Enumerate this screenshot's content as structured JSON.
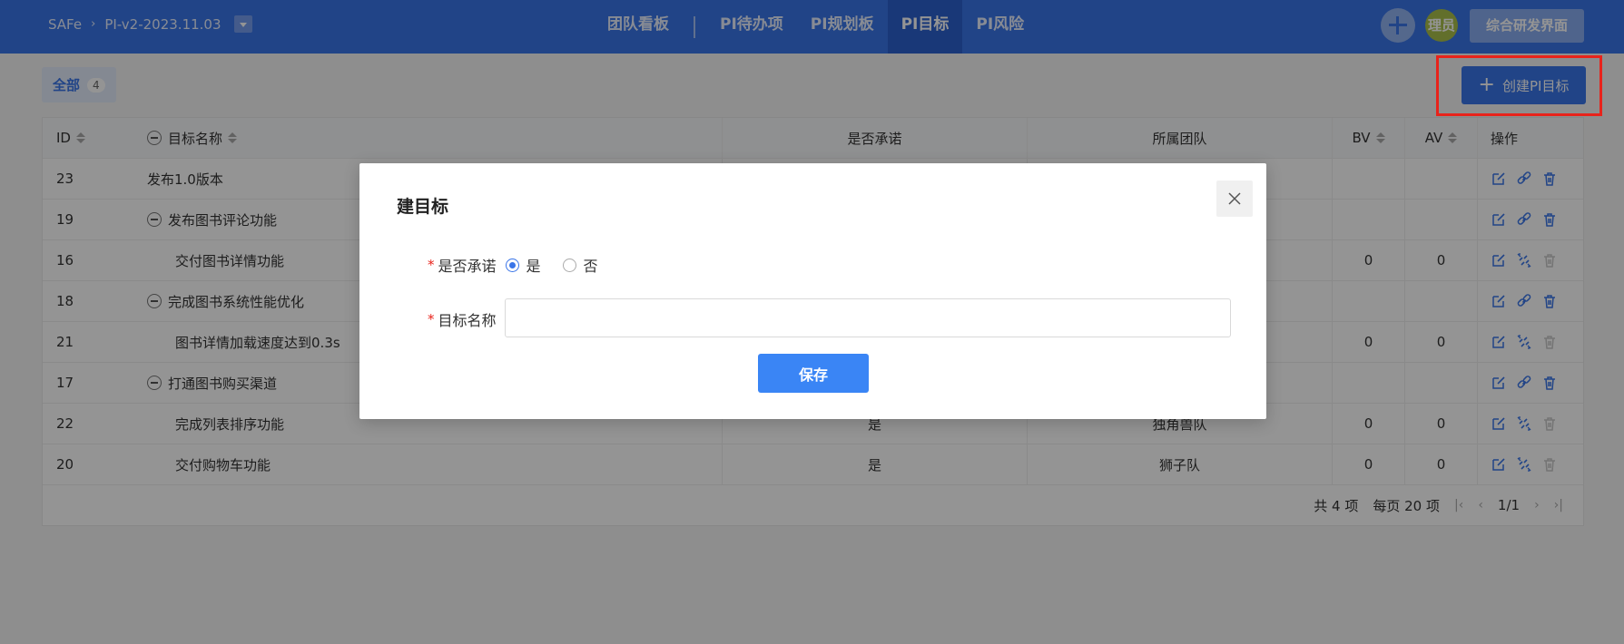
{
  "header": {
    "breadcrumb_root": "SAFe",
    "breadcrumb_sep": "›",
    "breadcrumb_pi": "PI-v2-2023.11.03",
    "nav": [
      {
        "label": "团队看板"
      },
      {
        "label": "PI待办项"
      },
      {
        "label": "PI规划板"
      },
      {
        "label": "PI目标"
      },
      {
        "label": "PI风险"
      }
    ],
    "avatar_text": "理员",
    "switch_label": "综合研发界面"
  },
  "toolbar": {
    "filter_label": "全部",
    "filter_count": "4",
    "create_plus": "+",
    "create_label": "创建PI目标"
  },
  "table": {
    "headers": {
      "id": "ID",
      "name": "目标名称",
      "commit": "是否承诺",
      "team": "所属团队",
      "bv": "BV",
      "av": "AV",
      "op": "操作"
    },
    "rows": [
      {
        "id": "23",
        "name": "发布1.0版本",
        "commit": "",
        "team": "",
        "bv": "",
        "av": ""
      },
      {
        "id": "19",
        "name": "发布图书评论功能",
        "commit": "",
        "team": "",
        "bv": "",
        "av": ""
      },
      {
        "id": "16",
        "name": "交付图书详情功能",
        "commit": "",
        "team": "",
        "bv": "0",
        "av": "0"
      },
      {
        "id": "18",
        "name": "完成图书系统性能优化",
        "commit": "",
        "team": "",
        "bv": "",
        "av": ""
      },
      {
        "id": "21",
        "name": "图书详情加载速度达到0.3s",
        "commit": "",
        "team": "",
        "bv": "0",
        "av": "0"
      },
      {
        "id": "17",
        "name": "打通图书购买渠道",
        "commit": "",
        "team": "",
        "bv": "",
        "av": ""
      },
      {
        "id": "22",
        "name": "完成列表排序功能",
        "commit": "是",
        "team": "独角兽队",
        "bv": "0",
        "av": "0"
      },
      {
        "id": "20",
        "name": "交付购物车功能",
        "commit": "是",
        "team": "狮子队",
        "bv": "0",
        "av": "0"
      }
    ],
    "icons": {
      "edit": "edit-icon",
      "link": "link-icon",
      "unlink": "unlink-icon",
      "delete": "trash-icon"
    }
  },
  "pager": {
    "total": "共 4 项",
    "page_size": "每页 20 项",
    "page": "1/1"
  },
  "modal": {
    "title": "建目标",
    "commit_label": "是否承诺",
    "commit_yes": "是",
    "commit_no": "否",
    "name_label": "目标名称",
    "name_value": "",
    "save_label": "保存"
  },
  "colors": {
    "brand": "#3a75e8",
    "highlight": "#e8231b"
  }
}
